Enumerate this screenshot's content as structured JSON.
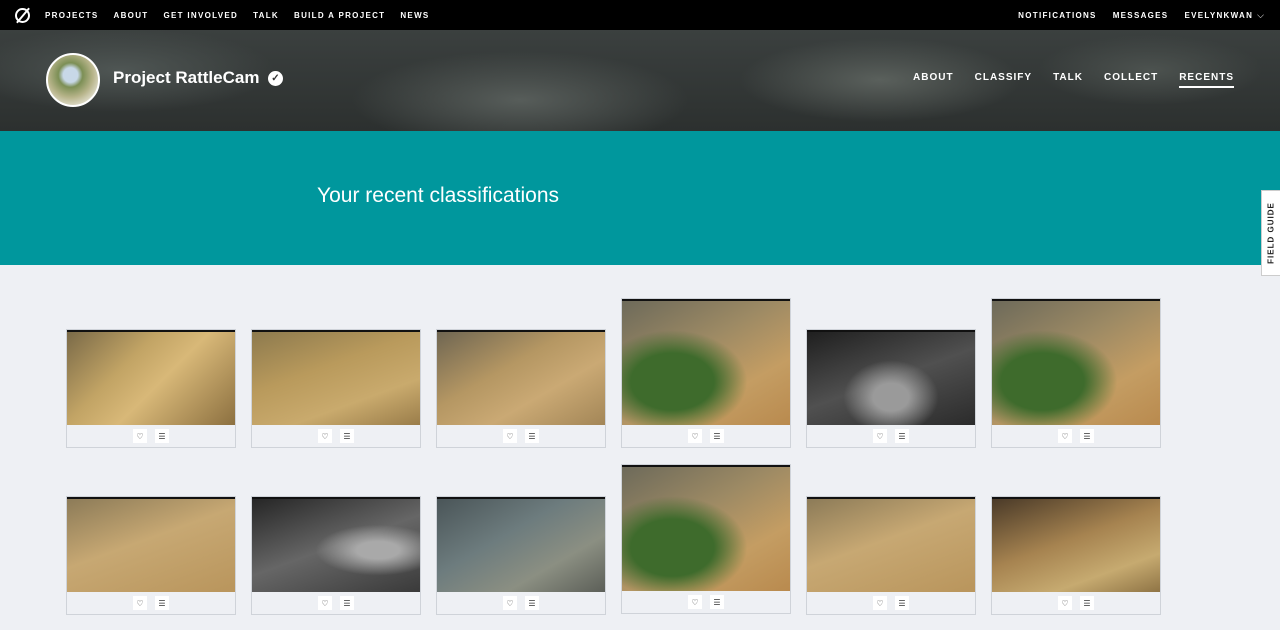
{
  "topnav": {
    "left": [
      "PROJECTS",
      "ABOUT",
      "GET INVOLVED",
      "TALK",
      "BUILD A PROJECT",
      "NEWS"
    ],
    "right": [
      "NOTIFICATIONS",
      "MESSAGES",
      "EVELYNKWAN"
    ]
  },
  "project": {
    "title": "Project RattleCam",
    "nav": [
      "ABOUT",
      "CLASSIFY",
      "TALK",
      "COLLECT",
      "RECENTS"
    ],
    "active_nav": "RECENTS"
  },
  "banner": {
    "title": "Your recent classifications"
  },
  "field_guide": "FIELD GUIDE",
  "icons": {
    "favorite": "heart-icon",
    "collect": "list-icon"
  },
  "colors": {
    "topbar": "#000000",
    "banner": "#00979d",
    "page": "#eef0f4"
  },
  "recents": [
    {
      "style": "t-day1"
    },
    {
      "style": "t-day2"
    },
    {
      "style": "t-day3"
    },
    {
      "style": "t-green"
    },
    {
      "style": "t-night"
    },
    {
      "style": "t-green"
    },
    {
      "style": "t-day4"
    },
    {
      "style": "t-night2"
    },
    {
      "style": "t-blue"
    },
    {
      "style": "t-green"
    },
    {
      "style": "t-day4"
    },
    {
      "style": "t-day5"
    }
  ]
}
